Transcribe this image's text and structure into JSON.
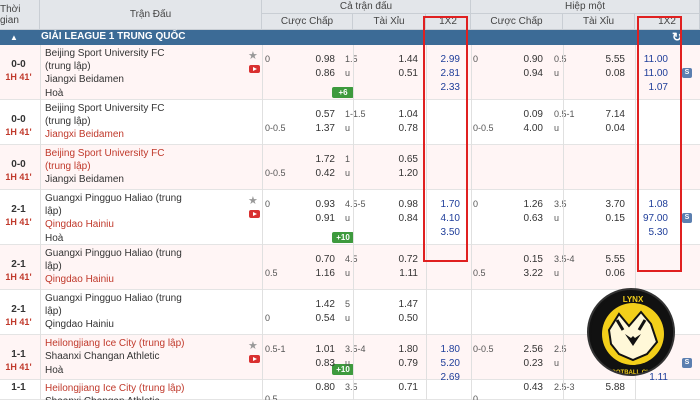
{
  "header": {
    "time": "Thời gian",
    "match": "Trận Đấu",
    "full_match": "Cả trận đấu",
    "half": "Hiệp một",
    "handicap": "Cược Chấp",
    "over_under": "Tài Xỉu",
    "x12": "1X2",
    "handicap2": "Cược Chấp",
    "over_under2": "Tài Xỉu",
    "x12_2": "1X2"
  },
  "league": {
    "title": "GIẢI LEAGUE 1 TRUNG QUỐC",
    "collapse_icon": "triangle-up-icon",
    "refresh_icon": "refresh-icon"
  },
  "rows": [
    {
      "score": "0-0",
      "time": "1H 41'",
      "home": "Beijing Sport University FC",
      "home2": "(trung lập)",
      "away": "Jiangxi Beidamen",
      "draw": "Hoà",
      "fh_hcap": "0",
      "fh_h": "0.98",
      "fh_a": "0.86",
      "fh_ou": "1.5",
      "fh_u": "u",
      "fh_o": "1.44",
      "fh_ou2": "0.51",
      "fx1": "2.99",
      "fx2": "2.81",
      "fxd": "2.33",
      "hh_hcap": "0",
      "hh_h": "0.90",
      "hh_a": "0.94",
      "hh_ou": "0.5",
      "hh_u": "u",
      "hh_o": "5.55",
      "hh_ou2": "0.08",
      "hx1": "11.00",
      "hx2": "11.00",
      "hxd": "1.07",
      "more": "+6"
    },
    {
      "score": "0-0",
      "time": "1H 41'",
      "home": "Beijing Sport University FC",
      "home2": "(trung lập)",
      "away": "Jiangxi Beidamen",
      "fh_hcap": "0-0.5",
      "fh_h": "0.57",
      "fh_a": "1.37",
      "fh_ou": "1-1.5",
      "fh_u": "u",
      "fh_o": "1.04",
      "fh_ou2": "0.78",
      "hh_hcap": "0-0.5",
      "hh_h": "0.09",
      "hh_a": "4.00",
      "hh_ou": "0.5-1",
      "hh_u": "u",
      "hh_o": "7.14",
      "hh_ou2": "0.04"
    },
    {
      "score": "0-0",
      "time": "1H 41'",
      "home": "Beijing Sport University FC",
      "home2": "(trung lập)",
      "away": "Jiangxi Beidamen",
      "fh_hcap": "0-0.5",
      "fh_h": "1.72",
      "fh_a": "0.42",
      "fh_ou": "1",
      "fh_u": "u",
      "fh_o": "0.65",
      "fh_ou2": "1.20"
    },
    {
      "score": "2-1",
      "time": "1H 41'",
      "home": "Guangxi Pingguo Haliao (trung",
      "home2": "lập)",
      "away": "Qingdao Hainiu",
      "draw": "Hoà",
      "fh_hcap": "0",
      "fh_h": "0.93",
      "fh_a": "0.91",
      "fh_ou": "4.5-5",
      "fh_u": "u",
      "fh_o": "0.98",
      "fh_ou2": "0.84",
      "fx1": "1.70",
      "fx2": "4.10",
      "fxd": "3.50",
      "hh_hcap": "0",
      "hh_h": "1.26",
      "hh_a": "0.63",
      "hh_ou": "3.5",
      "hh_u": "u",
      "hh_o": "3.70",
      "hh_ou2": "0.15",
      "hx1": "1.08",
      "hx2": "97.00",
      "hxd": "5.30",
      "more": "+10"
    },
    {
      "score": "2-1",
      "time": "1H 41'",
      "home": "Guangxi Pingguo Haliao (trung",
      "home2": "lập)",
      "away": "Qingdao Hainiu",
      "fh_hcap": "0.5",
      "fh_h": "0.70",
      "fh_a": "1.16",
      "fh_ou": "4.5",
      "fh_u": "u",
      "fh_o": "0.72",
      "fh_ou2": "1.11",
      "hh_hcap": "0.5",
      "hh_h": "0.15",
      "hh_a": "3.22",
      "hh_ou": "3.5-4",
      "hh_u": "u",
      "hh_o": "5.55",
      "hh_ou2": "0.06"
    },
    {
      "score": "2-1",
      "time": "1H 41'",
      "home": "Guangxi Pingguo Haliao (trung",
      "home2": "lập)",
      "away": "Qingdao Hainiu",
      "fh_hcap": "0",
      "fh_h": "1.42",
      "fh_a": "0.54",
      "fh_ou": "5",
      "fh_u": "u",
      "fh_o": "1.47",
      "fh_ou2": "0.50"
    },
    {
      "score": "1-1",
      "time": "1H 41'",
      "home": "Heilongjiang Ice City (trung lập)",
      "away": "Shaanxi Changan Athletic",
      "draw": "Hoà",
      "fh_hcap": "0.5-1",
      "fh_h": "1.01",
      "fh_a": "0.83",
      "fh_ou": "3.5-4",
      "fh_u": "u",
      "fh_o": "1.80",
      "fh_ou2": "0.79",
      "fx1": "1.80",
      "fx2": "5.20",
      "fxd": "2.69",
      "hh_hcap": "0-0.5",
      "hh_h": "2.56",
      "hh_a": "0.23",
      "hh_ou": "2.5",
      "hh_u": "u",
      "hh_o": "",
      "hh_ou2": "",
      "hxd": "1.11",
      "more": "+10"
    },
    {
      "score": "1-1",
      "time": "1H 41'",
      "home": "Heilongjiang Ice City (trung lập)",
      "away": "Shaanxi Changan Athletic",
      "fh_hcap": "0.5",
      "fh_h": "0.80",
      "fh_ou": "3.5",
      "fh_o": "0.71",
      "hh_hcap": "0",
      "hh_h": "0.43",
      "hh_ou": "2.5-3",
      "hh_o": "5.88"
    }
  ],
  "logo": {
    "brand": "LYNX",
    "sub": "FOOTBALL CLUB"
  },
  "side_button": "S"
}
